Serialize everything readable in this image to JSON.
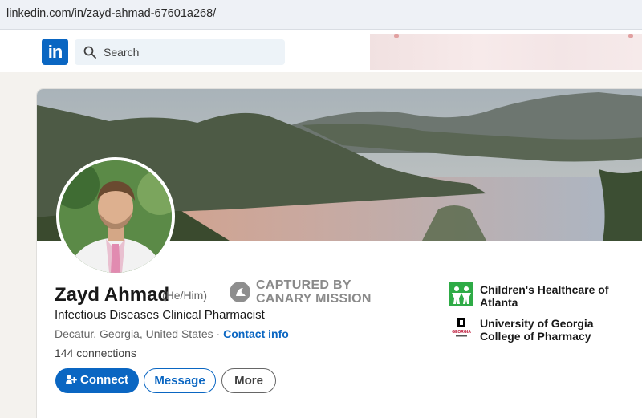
{
  "browser": {
    "url": "linkedin.com/in/zayd-ahmad-67601a268/"
  },
  "nav": {
    "logo_text": "in",
    "search_placeholder": "Search",
    "search_icon": "search-icon"
  },
  "profile": {
    "name": "Zayd Ahmad",
    "pronouns": "(He/Him)",
    "headline": "Infectious Diseases Clinical Pharmacist",
    "location": "Decatur, Georgia, United States",
    "location_separator": " · ",
    "contact_info_label": "Contact info",
    "connections": "144 connections"
  },
  "watermark": {
    "line1": "CAPTURED BY",
    "line2": "CANARY MISSION"
  },
  "actions": {
    "connect_label": "Connect",
    "message_label": "Message",
    "more_label": "More"
  },
  "organizations": [
    {
      "name": "Children's Healthcare of Atlanta",
      "logo": "childrens-healthcare-logo",
      "color": "#2eab46"
    },
    {
      "name": "University of Georgia College of Pharmacy",
      "logo": "uga-logo",
      "color": "#ba0c2f",
      "logo_text": "GEORGIA"
    }
  ],
  "colors": {
    "linkedin_blue": "#0a66c2",
    "page_background": "#f4f2ee"
  }
}
